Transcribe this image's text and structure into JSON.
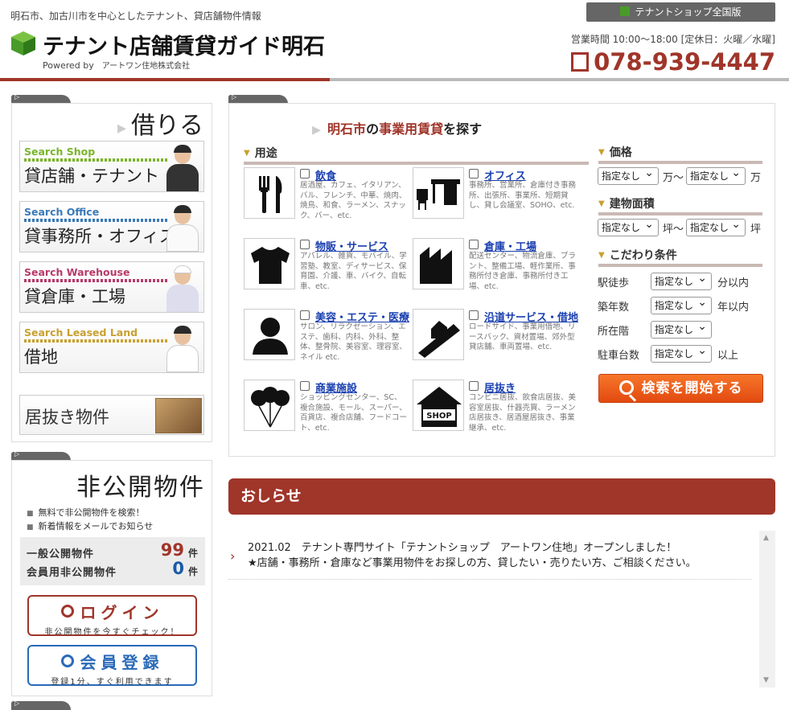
{
  "header": {
    "tagline": "明石市、加古川市を中心としたテナント、貸店舗物件情報",
    "logo_text": "テナント店舗賃貸ガイド明石",
    "powered_by": "Powered by",
    "company": "アートワン住地株式会社",
    "national_button": "テナントショップ全国版",
    "hours": "営業時間 10:00～18:00 [定休日：火曜／水曜]",
    "phone": "078-939-4447"
  },
  "rent_panel": {
    "title": "借りる",
    "categories": [
      {
        "en": "Search Shop",
        "jp": "貸店舗・テナント",
        "color": "#7ab52a"
      },
      {
        "en": "Search Office",
        "jp": "貸事務所・オフィス",
        "color": "#3a7ab8"
      },
      {
        "en": "Search Warehouse",
        "jp": "貸倉庫・工場",
        "color": "#b83a6a"
      },
      {
        "en": "Search Leased Land",
        "jp": "借地",
        "color": "#c9a030"
      }
    ],
    "inuki": "居抜き物件"
  },
  "private_panel": {
    "title": "非公開物件",
    "bullets": [
      "無料で非公開物件を検索！",
      "新着情報をメールでお知らせ"
    ],
    "general_label": "一般公開物件",
    "general_count": "99",
    "member_label": "会員用非公開物件",
    "member_count": "0",
    "unit": "件",
    "login_label": "ログイン",
    "login_sub": "非公開物件を今すぐチェック！",
    "register_label": "会員登録",
    "register_sub": "登録1分、すぐ利用できます"
  },
  "search": {
    "title_city": "明石市",
    "title_mid": "の",
    "title_key": "事業用賃貸",
    "title_end": "を探す",
    "use_heading": "用途",
    "uses": [
      {
        "name": "飲食",
        "desc": "居酒屋、カフェ、イタリアン、バル、フレンチ、中華、焼肉、焼鳥、和食、ラーメン、スナック、バー、etc.",
        "icon": "fork-knife-icon"
      },
      {
        "name": "オフィス",
        "desc": "事務所、営業所、倉庫付き事務所、出張所、事業所、短期貸し、貸し会議室、SOHO、etc.",
        "icon": "desk-icon"
      },
      {
        "name": "物販・サービス",
        "desc": "アパレル、雑貨、モバイル、学習塾、教室、ディサービス、保育園、介護、車、バイク、自転車、etc.",
        "icon": "tshirt-icon"
      },
      {
        "name": "倉庫・工場",
        "desc": "配送センター、物流倉庫、ブラント、整備工場、軽作業所、事務所付き倉庫、事務所付き工場、etc.",
        "icon": "factory-icon"
      },
      {
        "name": "美容・エステ・医療",
        "desc": "サロン、リラクゼーション、エステ、歯科、内科、外科、整体、整骨院、美容室、理容室、ネイル etc.",
        "icon": "person-icon"
      },
      {
        "name": "沿道サービス・借地",
        "desc": "ロードサイド、事業用借地、リースバック、資材置場、郊外型貸店舗、車両置場、etc.",
        "icon": "road-house-icon"
      },
      {
        "name": "商業施設",
        "desc": "ショッピングセンター、SC、複合施設、モール、スーパー、百貨店、複合店舗、フードコート、etc.",
        "icon": "balloons-icon"
      },
      {
        "name": "居抜き",
        "desc": "コンビニ居抜、飲食店居抜、美容室居抜、什器売買、ラーメン店居抜き、居酒屋居抜き、事業継承、etc.",
        "icon": "shop-icon"
      }
    ],
    "price_heading": "価格",
    "area_heading": "建物面積",
    "cond_heading": "こだわり条件",
    "select_default": "指定なし",
    "unit_man_range": "万～",
    "unit_man": "万",
    "unit_tsubo_range": "坪～",
    "unit_tsubo": "坪",
    "conditions": [
      {
        "label": "駅徒歩",
        "suffix": "分以内"
      },
      {
        "label": "築年数",
        "suffix": "年以内"
      },
      {
        "label": "所在階",
        "suffix": ""
      },
      {
        "label": "駐車台数",
        "suffix": "以上"
      }
    ],
    "shop_sign": "SHOP",
    "search_button": "検索を開始する"
  },
  "news": {
    "heading": "おしらせ",
    "line1": "2021.02　テナント専門サイト「テナントショップ　アートワン住地」オープンしました！",
    "line2": "★店舗・事務所・倉庫など事業用物件をお探しの方、貸したい・売りたい方、ご相談ください。"
  }
}
